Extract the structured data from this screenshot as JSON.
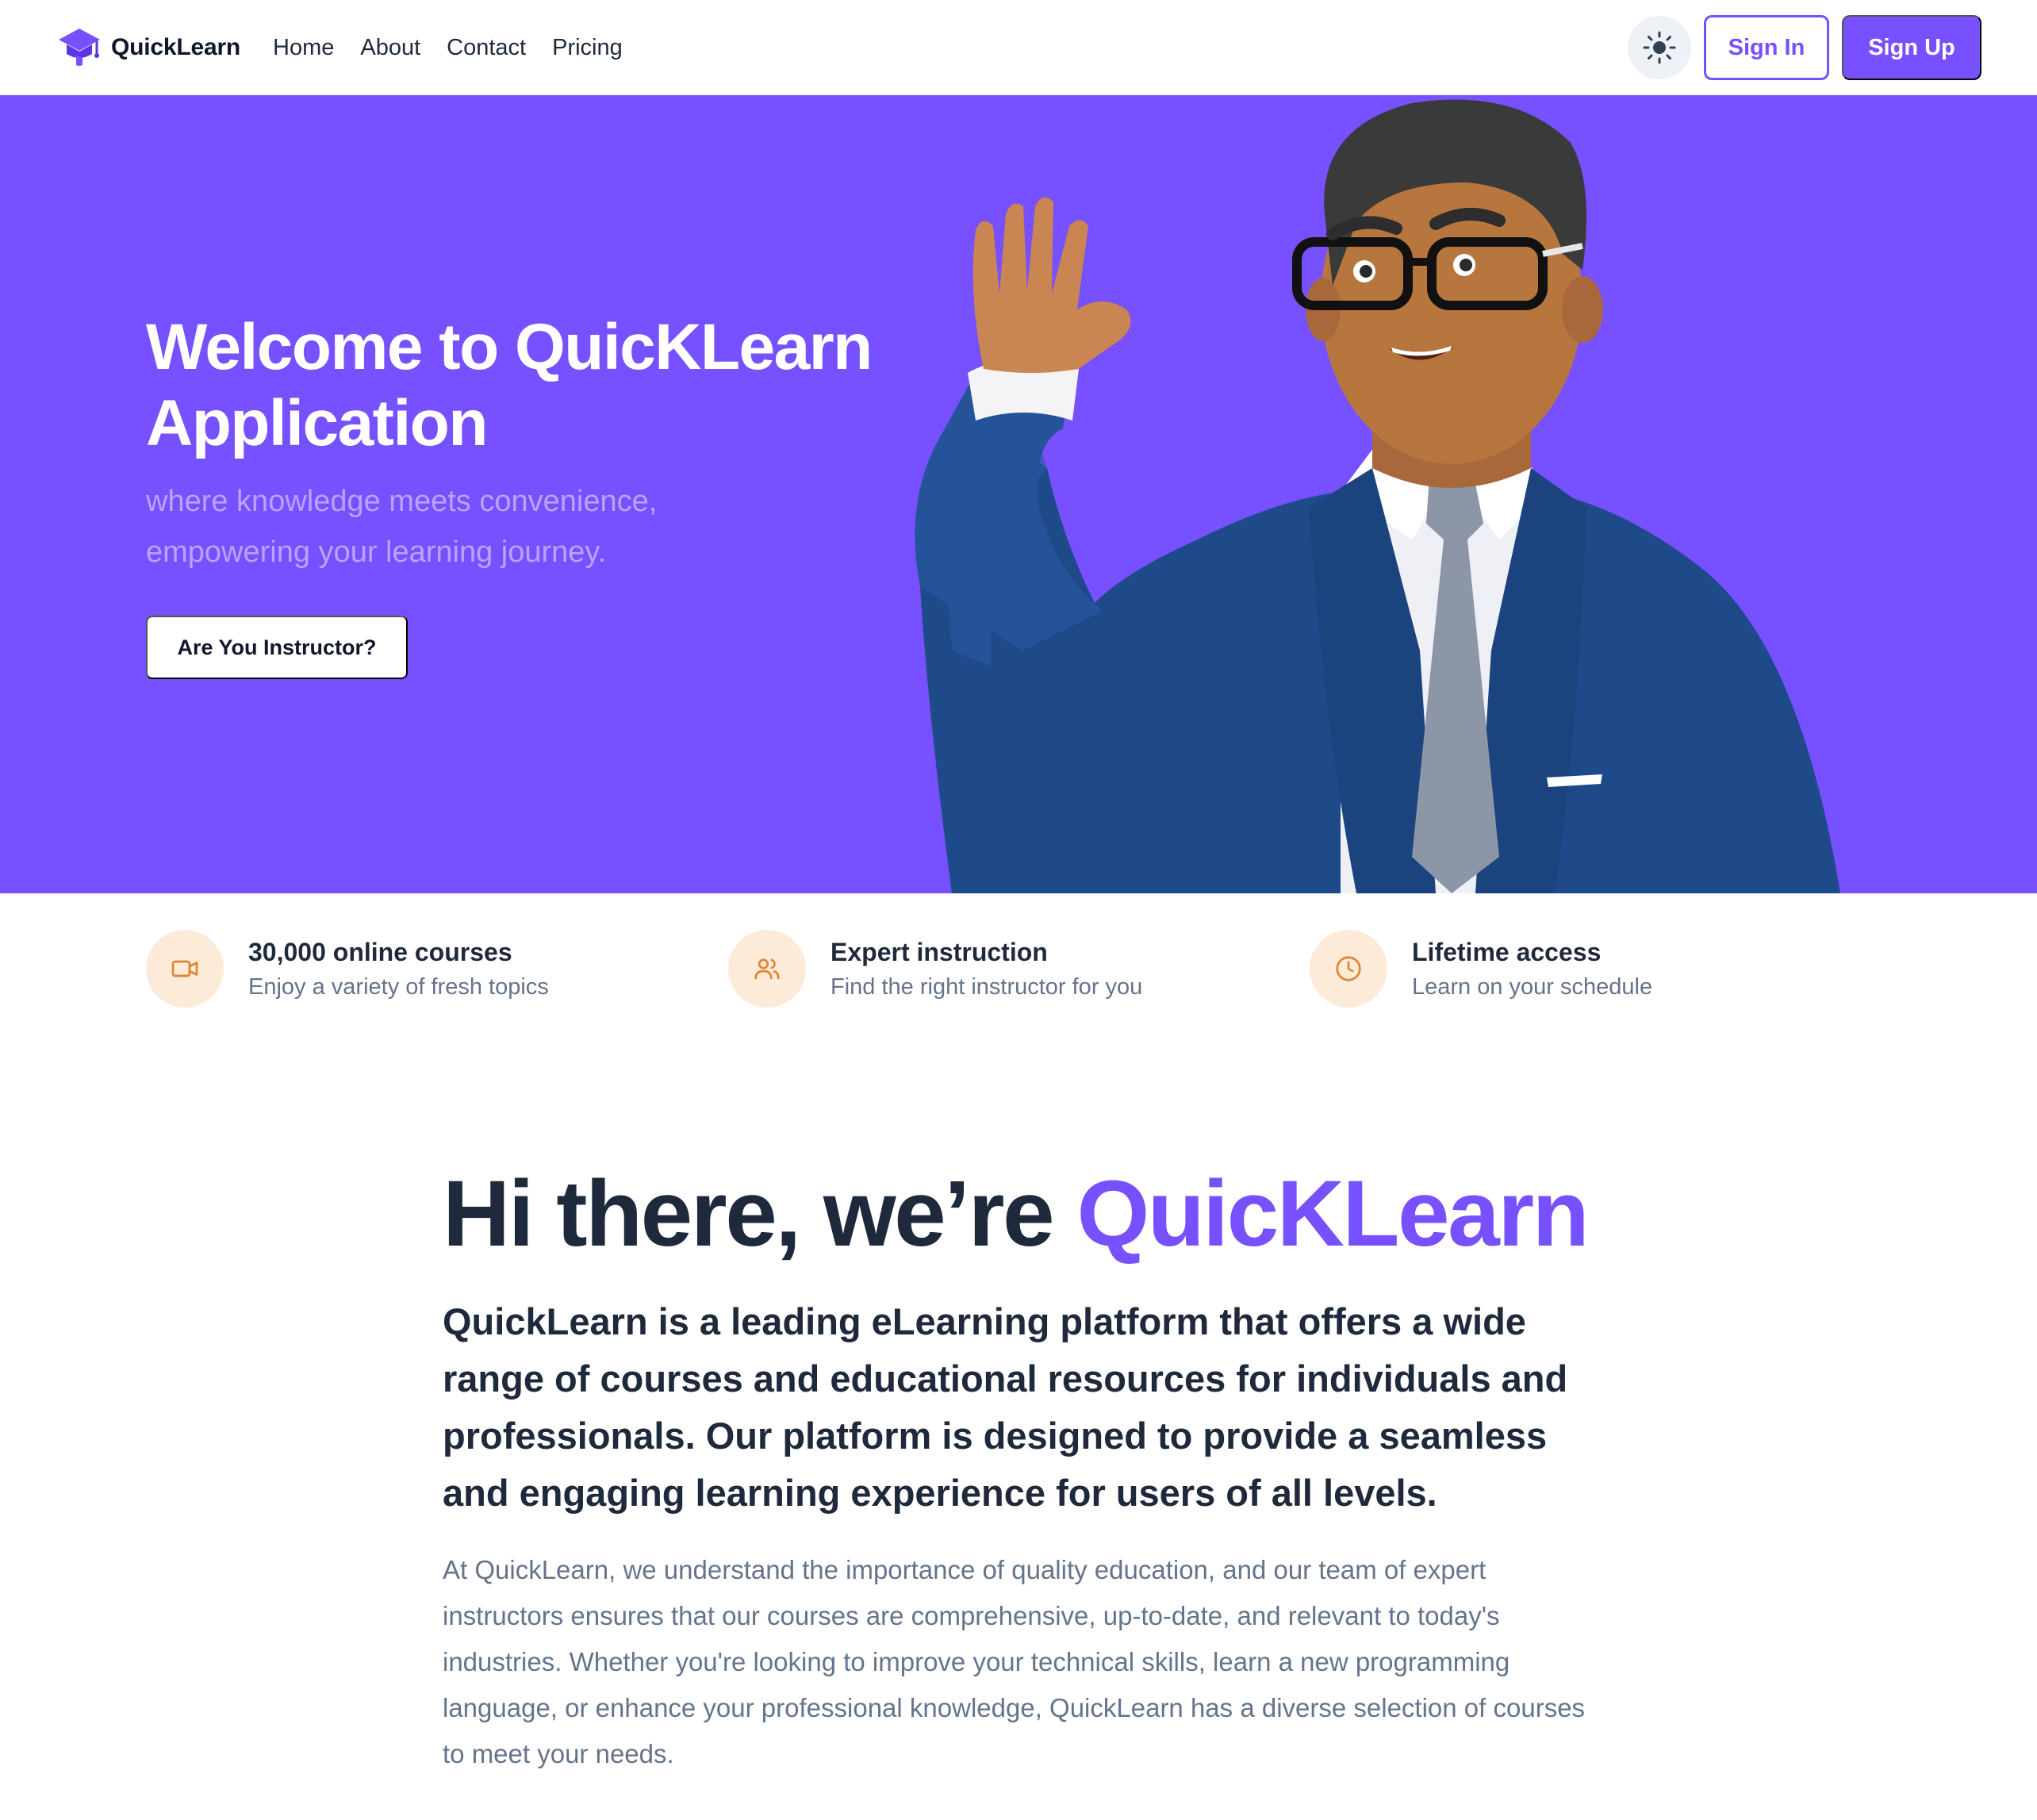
{
  "navbar": {
    "logo_text": "QuickLearn",
    "links": [
      "Home",
      "About",
      "Contact",
      "Pricing"
    ],
    "theme_toggle_icon": "sun-icon",
    "sign_in_label": "Sign In",
    "sign_up_label": "Sign Up"
  },
  "hero": {
    "title": "Welcome to QuicKLearn Application",
    "subtitle": "where knowledge meets convenience, empowering your learning journey.",
    "cta_label": "Are You Instructor?"
  },
  "features": [
    {
      "icon": "video-camera-icon",
      "title": "30,000 online courses",
      "description": "Enjoy a variety of fresh topics"
    },
    {
      "icon": "users-icon",
      "title": "Expert instruction",
      "description": "Find the right instructor for you"
    },
    {
      "icon": "clock-icon",
      "title": "Lifetime access",
      "description": "Learn on your schedule"
    }
  ],
  "about": {
    "heading_prefix": "Hi there, we’re ",
    "heading_brand": "QuicKLearn",
    "lead": "QuickLearn is a leading eLearning platform that offers a wide range of courses and educational resources for individuals and professionals. Our platform is designed to provide a seamless and engaging learning experience for users of all levels.",
    "body": "At QuickLearn, we understand the importance of quality education, and our team of expert instructors ensures that our courses are comprehensive, up-to-date, and relevant to today's industries. Whether you're looking to improve your technical skills, learn a new programming language, or enhance your professional knowledge, QuickLearn has a diverse selection of courses to meet your needs."
  },
  "colors": {
    "brand": "#7750ff",
    "hero_subtitle": "#b7a4ff",
    "feature_icon_bg": "#fdebd9",
    "feature_icon": "#e0852f",
    "text_dark": "#1e293b",
    "text_muted": "#64748b"
  }
}
